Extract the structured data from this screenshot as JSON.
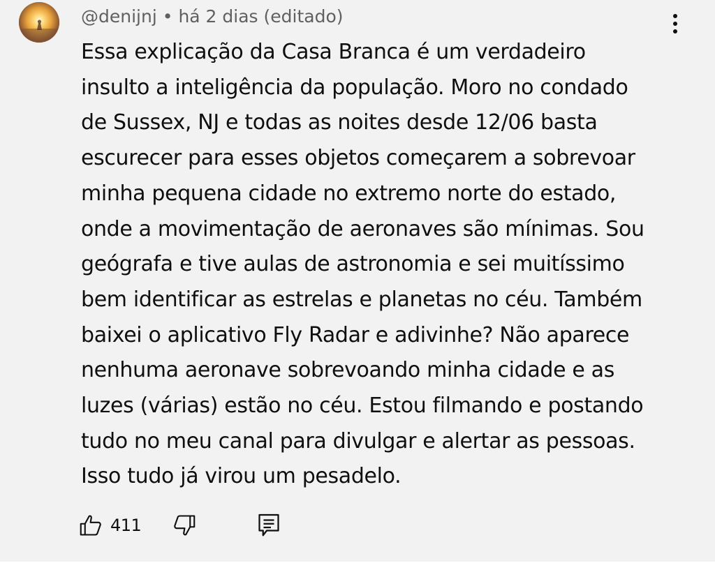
{
  "comment": {
    "handle": "@denijnj",
    "separator": "•",
    "time": "há 2 dias (editado)",
    "text_lines": [
      "Essa explicação da Casa Branca é um verdadeiro",
      "insulto a inteligência da população. Moro no condado",
      "de Sussex, NJ e todas as noites desde 12/06 basta",
      "escurecer para esses objetos começarem a sobrevoar",
      "minha pequena cidade no extremo norte do estado,",
      "onde a movimentação de aeronaves são mínimas. Sou",
      "geógrafa e tive aulas de astronomia e sei muitíssimo",
      "bem identificar as estrelas e planetas no céu. Também",
      "baixei o aplicativo Fly Radar e adivinhe? Não aparece",
      "nenhuma aeronave sobrevoando minha cidade e as",
      "luzes (várias) estão no céu. Estou filmando e postando",
      "tudo no meu canal para divulgar e alertar as pessoas.",
      "Isso tudo já virou um pesadelo."
    ],
    "like_count": "411"
  },
  "icons": {
    "avatar": "avatar-image",
    "menu": "more-vert-icon",
    "like": "thumb-up-icon",
    "dislike": "thumb-down-icon",
    "reply": "comment-reply-icon"
  },
  "colors": {
    "background": "#f2f2f2",
    "text": "#0f0f0f",
    "meta": "#606060"
  }
}
